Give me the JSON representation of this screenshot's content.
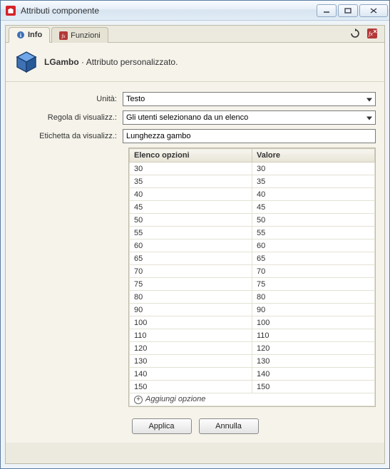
{
  "window": {
    "title": "Attributi componente"
  },
  "tabs": {
    "info": "Info",
    "functions": "Funzioni"
  },
  "header": {
    "name": "LGambo",
    "separator": " · ",
    "description": "Attributo personalizzato."
  },
  "form": {
    "units_label": "Unità:",
    "units_value": "Testo",
    "rule_label": "Regola di visualizz.:",
    "rule_value": "Gli utenti selezionano da un elenco",
    "dlabel_label": "Etichetta da visualizz.:",
    "dlabel_value": "Lunghezza gambo"
  },
  "table": {
    "col_options": "Elenco opzioni",
    "col_value": "Valore",
    "rows": [
      {
        "opt": "30",
        "val": "30"
      },
      {
        "opt": "35",
        "val": "35"
      },
      {
        "opt": "40",
        "val": "40"
      },
      {
        "opt": "45",
        "val": "45"
      },
      {
        "opt": "50",
        "val": "50"
      },
      {
        "opt": "55",
        "val": "55"
      },
      {
        "opt": "60",
        "val": "60"
      },
      {
        "opt": "65",
        "val": "65"
      },
      {
        "opt": "70",
        "val": "70"
      },
      {
        "opt": "75",
        "val": "75"
      },
      {
        "opt": "80",
        "val": "80"
      },
      {
        "opt": "90",
        "val": "90"
      },
      {
        "opt": "100",
        "val": "100"
      },
      {
        "opt": "110",
        "val": "110"
      },
      {
        "opt": "120",
        "val": "120"
      },
      {
        "opt": "130",
        "val": "130"
      },
      {
        "opt": "140",
        "val": "140"
      },
      {
        "opt": "150",
        "val": "150"
      }
    ],
    "add_label": "Aggiungi opzione"
  },
  "buttons": {
    "apply": "Applica",
    "cancel": "Annulla"
  }
}
